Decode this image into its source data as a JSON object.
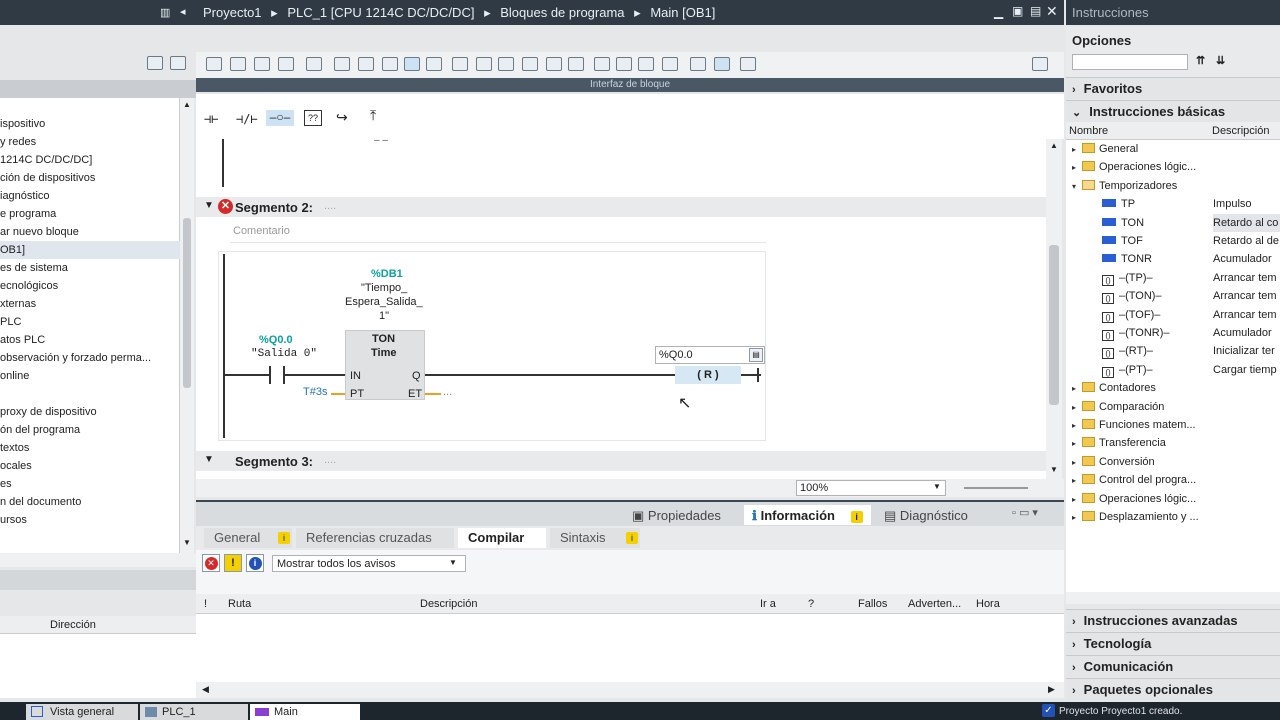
{
  "editor_title": {
    "crumbs": [
      "Proyecto1",
      "PLC_1 [CPU 1214C DC/DC/DC]",
      "Bloques de programa",
      "Main [OB1]"
    ]
  },
  "right_panel": {
    "title": "Instrucciones",
    "options_label": "Opciones",
    "favorites": "Favoritos",
    "basic": "Instrucciones básicas",
    "col_name": "Nombre",
    "col_desc": "Descripción",
    "tree": [
      {
        "name": "General",
        "desc": "",
        "level": 0,
        "icon": "folder-icon",
        "arrow": "▸"
      },
      {
        "name": "Operaciones lógic...",
        "desc": "",
        "level": 0,
        "icon": "folder-icon",
        "arrow": "▸"
      },
      {
        "name": "Temporizadores",
        "desc": "",
        "level": 0,
        "icon": "timer-icon",
        "arrow": "▾"
      },
      {
        "name": "TP",
        "desc": "Impulso",
        "level": 1,
        "icon": "block-icon"
      },
      {
        "name": "TON",
        "desc": "Retardo al co",
        "level": 1,
        "icon": "block-icon",
        "selected": true
      },
      {
        "name": "TOF",
        "desc": "Retardo al de",
        "level": 1,
        "icon": "block-icon"
      },
      {
        "name": "TONR",
        "desc": "Acumulador",
        "level": 1,
        "icon": "block-icon"
      },
      {
        "name": "–(TP)–",
        "desc": "Arrancar tem",
        "level": 1,
        "icon": "coil-icon"
      },
      {
        "name": "–(TON)–",
        "desc": "Arrancar tem",
        "level": 1,
        "icon": "coil-icon"
      },
      {
        "name": "–(TOF)–",
        "desc": "Arrancar tem",
        "level": 1,
        "icon": "coil-icon"
      },
      {
        "name": "–(TONR)–",
        "desc": "Acumulador",
        "level": 1,
        "icon": "coil-icon"
      },
      {
        "name": "–(RT)–",
        "desc": "Inicializar ter",
        "level": 1,
        "icon": "coil-icon"
      },
      {
        "name": "–(PT)–",
        "desc": "Cargar tiemp",
        "level": 1,
        "icon": "coil-icon"
      },
      {
        "name": "Contadores",
        "desc": "",
        "level": 0,
        "icon": "folder-icon",
        "arrow": "▸"
      },
      {
        "name": "Comparación",
        "desc": "",
        "level": 0,
        "icon": "folder-icon",
        "arrow": "▸"
      },
      {
        "name": "Funciones matem...",
        "desc": "",
        "level": 0,
        "icon": "folder-icon",
        "arrow": "▸"
      },
      {
        "name": "Transferencia",
        "desc": "",
        "level": 0,
        "icon": "folder-icon",
        "arrow": "▸"
      },
      {
        "name": "Conversión",
        "desc": "",
        "level": 0,
        "icon": "folder-icon",
        "arrow": "▸"
      },
      {
        "name": "Control del progra...",
        "desc": "",
        "level": 0,
        "icon": "folder-icon",
        "arrow": "▸"
      },
      {
        "name": "Operaciones lógic...",
        "desc": "",
        "level": 0,
        "icon": "folder-icon",
        "arrow": "▸"
      },
      {
        "name": "Desplazamiento y ...",
        "desc": "",
        "level": 0,
        "icon": "folder-icon",
        "arrow": "▸"
      }
    ],
    "advanced": "Instrucciones avanzadas",
    "technology": "Tecnología",
    "communication": "Comunicación",
    "optional": "Paquetes opcionales"
  },
  "left_tree": {
    "items": [
      "ispositivo",
      "y redes",
      "1214C DC/DC/DC]",
      "ción de dispositivos",
      "iagnóstico",
      "e programa",
      "ar nuevo bloque",
      "OB1]",
      "es de sistema",
      "ecnológicos",
      "xternas",
      "PLC",
      "atos PLC",
      "observación y forzado perma...",
      "online",
      "",
      "proxy de dispositivo",
      "ón del programa",
      "textos",
      "ocales",
      "es",
      "n del documento",
      "ursos"
    ],
    "bottom_col": "Dirección"
  },
  "editor": {
    "interface_label": "Interfaz de bloque",
    "seg2_title": "Segmento 2:",
    "seg2_dots": "....",
    "comment_placeholder": "Comentario",
    "db_addr": "%DB1",
    "db_name_l1": "\"Tiempo_",
    "db_name_l2": "Espera_Salida_",
    "db_name_l3": "1\"",
    "contact_addr": "%Q0.0",
    "contact_name": "\"Salida 0\"",
    "ton_title": "TON",
    "ton_sub": "Time",
    "pin_in": "IN",
    "pin_pt": "PT",
    "pin_q": "Q",
    "pin_et": "ET",
    "pt_value": "T#3s",
    "et_value": "...",
    "coil_operand": "%Q0.0",
    "coil_label": "R",
    "seg3_title": "Segmento 3:",
    "seg3_dots": "....",
    "zoom": "100%",
    "top_dash": "– –"
  },
  "inspector": {
    "props": "Propiedades",
    "info": "Información",
    "diag": "Diagnóstico",
    "tabs": [
      "General",
      "Referencias cruzadas",
      "Compilar",
      "Sintaxis"
    ],
    "filter": "Mostrar todos los avisos",
    "cols": [
      "!",
      "Ruta",
      "Descripción",
      "Ir a",
      "?",
      "Fallos",
      "Adverten...",
      "Hora"
    ]
  },
  "taskbar": {
    "items": [
      "Vista general",
      "PLC_1",
      "Main"
    ],
    "status": "Proyecto Proyecto1 creado."
  },
  "colors": {
    "accent_teal": "#0aa3a0",
    "header": "#2f3a44",
    "error_red": "#d42a2a"
  }
}
